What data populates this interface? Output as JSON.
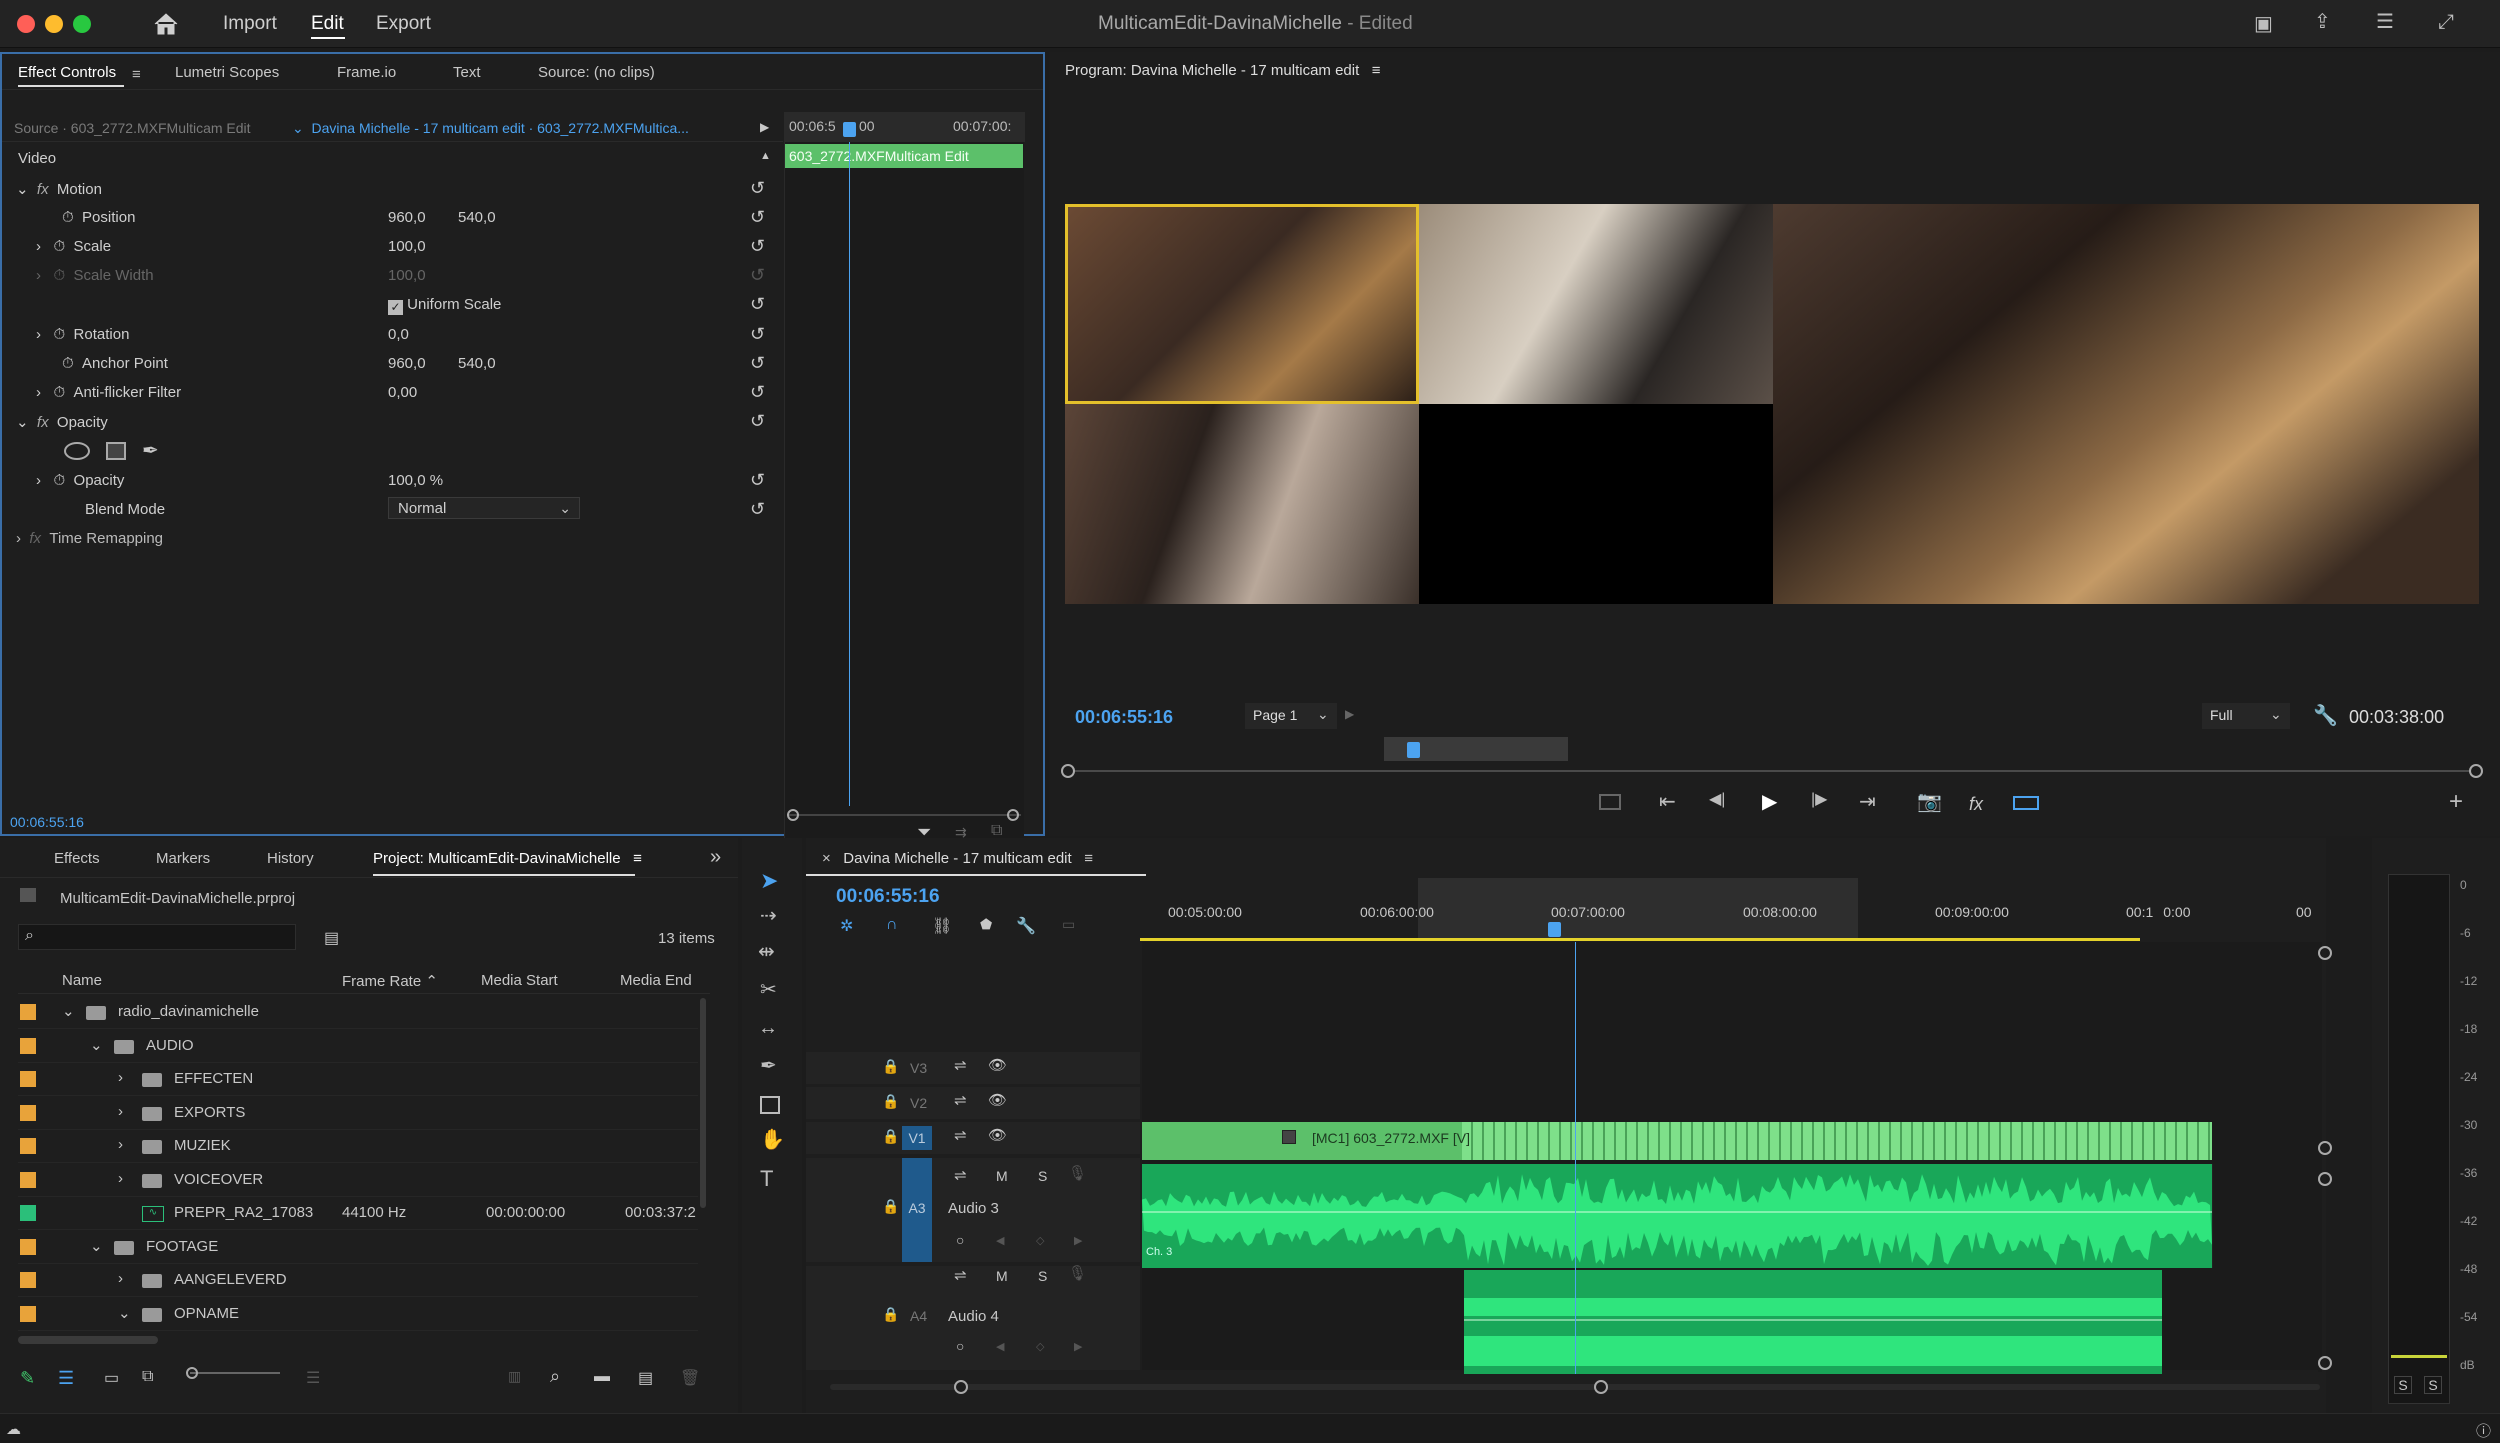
{
  "app": {
    "title": "MulticamEdit-DavinaMichelle",
    "status": "- Edited",
    "menu": [
      "Import",
      "Edit",
      "Export"
    ],
    "active_menu": "Edit"
  },
  "colors": {
    "accent": "#4ca3f0",
    "clip": "#5cc06a",
    "audio": "#21c36d",
    "folder": "#e8a33a",
    "selected_frame": "#e4c02b"
  },
  "ec": {
    "tabs": [
      "Effect Controls",
      "Lumetri Scopes",
      "Frame.io",
      "Text",
      "Source: (no clips)"
    ],
    "source_label": "Source · 603_2772.MXFMulticam Edit",
    "seq_label": "Davina Michelle - 17 multicam edit · 603_2772.MXFMultica...",
    "mini_time_a": "00:06:5",
    "mini_time_b": "00",
    "mini_time_end": "00:07:00:",
    "mini_clip": "603_2772.MXFMulticam Edit",
    "video": "Video",
    "motion": "Motion",
    "position": "Position",
    "pos_x": "960,0",
    "pos_y": "540,0",
    "scale": "Scale",
    "scale_val": "100,0",
    "scale_width": "Scale Width",
    "scale_width_val": "100,0",
    "uniform": "Uniform Scale",
    "rotation": "Rotation",
    "rotation_val": "0,0",
    "anchor": "Anchor Point",
    "anchor_x": "960,0",
    "anchor_y": "540,0",
    "antiflicker": "Anti-flicker Filter",
    "antiflicker_val": "0,00",
    "opacity_fx": "Opacity",
    "opacity": "Opacity",
    "opacity_val": "100,0 %",
    "blend": "Blend Mode",
    "blend_val": "Normal",
    "time_remap": "Time Remapping",
    "timecode": "00:06:55:16"
  },
  "program": {
    "title": "Program: Davina Michelle - 17 multicam edit",
    "timecode": "00:06:55:16",
    "page": "Page 1",
    "quality": "Full",
    "duration": "00:03:38:00"
  },
  "project": {
    "tabs": [
      "Effects",
      "Markers",
      "History",
      "Project: MulticamEdit-DavinaMichelle"
    ],
    "file": "MulticamEdit-DavinaMichelle.prproj",
    "count": "13 items",
    "cols": [
      "Name",
      "Frame Rate",
      "Media Start",
      "Media End"
    ],
    "rows": [
      {
        "name": "radio_davinamichelle",
        "type": "folder",
        "level": 0,
        "exp": "open",
        "color": "#e8a33a"
      },
      {
        "name": "AUDIO",
        "type": "folder",
        "level": 1,
        "exp": "open",
        "color": "#e8a33a"
      },
      {
        "name": "EFFECTEN",
        "type": "folder",
        "level": 2,
        "exp": "closed",
        "color": "#e8a33a"
      },
      {
        "name": "EXPORTS",
        "type": "folder",
        "level": 2,
        "exp": "closed",
        "color": "#e8a33a"
      },
      {
        "name": "MUZIEK",
        "type": "folder",
        "level": 2,
        "exp": "closed",
        "color": "#e8a33a"
      },
      {
        "name": "VOICEOVER",
        "type": "folder",
        "level": 2,
        "exp": "closed",
        "color": "#e8a33a"
      },
      {
        "name": "PREPR_RA2_17083",
        "type": "audio",
        "level": 2,
        "exp": "",
        "color": "#2bbf7a",
        "fr": "44100 Hz",
        "ms": "00:00:00:00",
        "me": "00:03:37:2"
      },
      {
        "name": "FOOTAGE",
        "type": "folder",
        "level": 1,
        "exp": "open",
        "color": "#e8a33a"
      },
      {
        "name": "AANGELEVERD",
        "type": "folder",
        "level": 2,
        "exp": "closed",
        "color": "#e8a33a"
      },
      {
        "name": "OPNAME",
        "type": "folder",
        "level": 2,
        "exp": "open",
        "color": "#e8a33a"
      }
    ]
  },
  "timeline": {
    "title": "Davina Michelle - 17 multicam edit",
    "timecode": "00:06:55:16",
    "ruler": [
      "00:05:00:00",
      "00:06:00:00",
      "00:07:00:00",
      "00:08:00:00",
      "00:09:00:00",
      "00:1",
      "0:00",
      "00"
    ],
    "tracks": [
      "V3",
      "V2",
      "V1",
      "A3",
      "A4"
    ],
    "audio3": "Audio 3",
    "audio4": "Audio 4",
    "clip": "[MC1] 603_2772.MXF [V]",
    "ch": "Ch. 3",
    "m": "M",
    "s": "S",
    "fx": "fx"
  },
  "meter": {
    "ticks": [
      "0",
      "-6",
      "-12",
      "-18",
      "-24",
      "-30",
      "-36",
      "-42",
      "-48",
      "-54",
      "dB"
    ],
    "s1": "S",
    "s2": "S"
  }
}
